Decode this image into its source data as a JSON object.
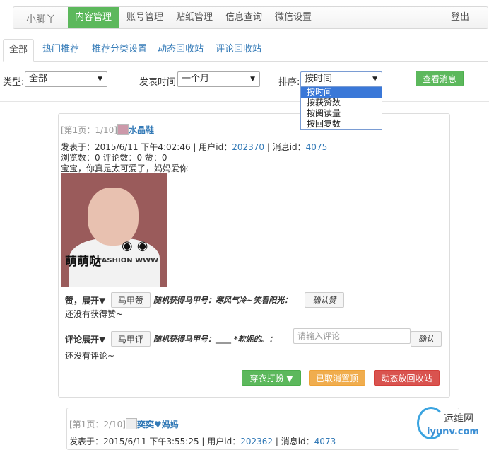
{
  "nav": {
    "brand": "小脚丫",
    "items": [
      "内容管理",
      "账号管理",
      "贴纸管理",
      "信息查询",
      "微信设置"
    ],
    "logout": "登出"
  },
  "tabs": [
    "全部",
    "热门推荐",
    "推荐分类设置",
    "动态回收站",
    "评论回收站"
  ],
  "filters": {
    "type_label": "类型:",
    "type_value": "全部",
    "time_label": "发表时间",
    "time_value": "一个月",
    "sort_label": "排序:",
    "sort_value": "按时间",
    "sort_options": [
      "按时间",
      "按获赞数",
      "按阅读量",
      "按回复数"
    ],
    "query_button": "查看消息"
  },
  "posts": [
    {
      "page": "[第1页：1/10]",
      "user": "水晶鞋",
      "published": "发表于：2015/6/11 下午4:02:46 | 用户id：",
      "user_id": "202370",
      "msg_sep": " | 消息id：",
      "msg_id": "4075",
      "stats": "浏览数：0 评论数：0 赞：0",
      "content": "宝宝，你真是太可爱了，妈妈爱你",
      "photo_caption": "萌萌哒",
      "photo_text": "FASHION WWW",
      "like_expand": "赞，展开▼",
      "like_vest_button": "马甲赞",
      "like_vest_info": "随机获得马甲号：寒风气冷~笑看阳光：",
      "like_confirm": "确认赞",
      "no_likes": "还没有获得赞~",
      "comment_expand": "评论展开▼",
      "comment_vest_button": "马甲评",
      "comment_vest_info": "随机获得马甲号：____ *软妮的。：",
      "comment_placeholder": "请输入评论",
      "comment_confirm": "确认",
      "no_comments": "还没有评论~",
      "btn_dress": "穿衣打扮 ▼",
      "btn_cancel_top": "已取消置顶",
      "btn_recycle": "动态放回收站"
    },
    {
      "page": "[第1页：2/10]",
      "user": "奕奕♥妈妈",
      "published": "发表于：2015/6/11 下午3:55:25 | 用户id：",
      "user_id": "202362",
      "msg_sep": " | 消息id：",
      "msg_id": "4073"
    }
  ],
  "watermark": {
    "cn": "运维网",
    "en": "iyunv.com"
  }
}
